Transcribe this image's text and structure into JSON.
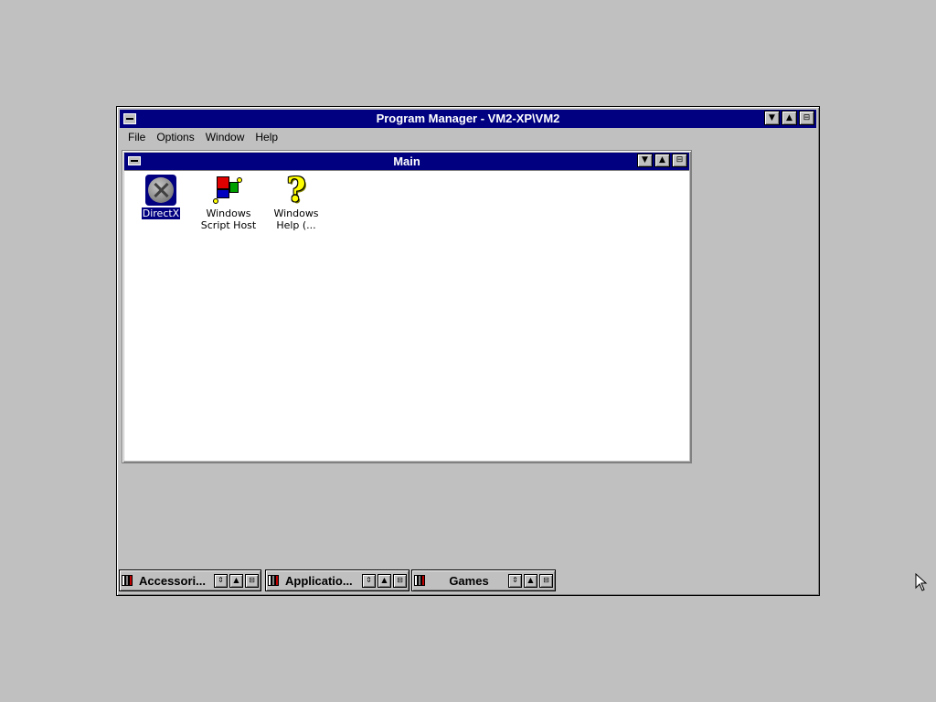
{
  "program_manager": {
    "title": "Program Manager - VM2-XP\\VM2",
    "buttons": {
      "minimize": "▼",
      "maximize": "▲",
      "restore": "⊟"
    },
    "menu": [
      {
        "label": "File"
      },
      {
        "label": "Options"
      },
      {
        "label": "Window"
      },
      {
        "label": "Help"
      }
    ]
  },
  "main_group": {
    "title": "Main",
    "icons": [
      {
        "label": "DirectX",
        "selected": true,
        "icon": "directx-icon"
      },
      {
        "label": "Windows Script Host",
        "icon": "windows-script-host-icon"
      },
      {
        "label": "Windows Help (...",
        "icon": "help-question-icon"
      }
    ]
  },
  "minimized_groups": [
    {
      "label": "Accessori..."
    },
    {
      "label": "Applicatio..."
    },
    {
      "label": "Games"
    }
  ],
  "colors": {
    "titlebar": "#000080",
    "desktop": "#c0c0c0",
    "window_bg": "#ffffff",
    "selection": "#000080"
  }
}
